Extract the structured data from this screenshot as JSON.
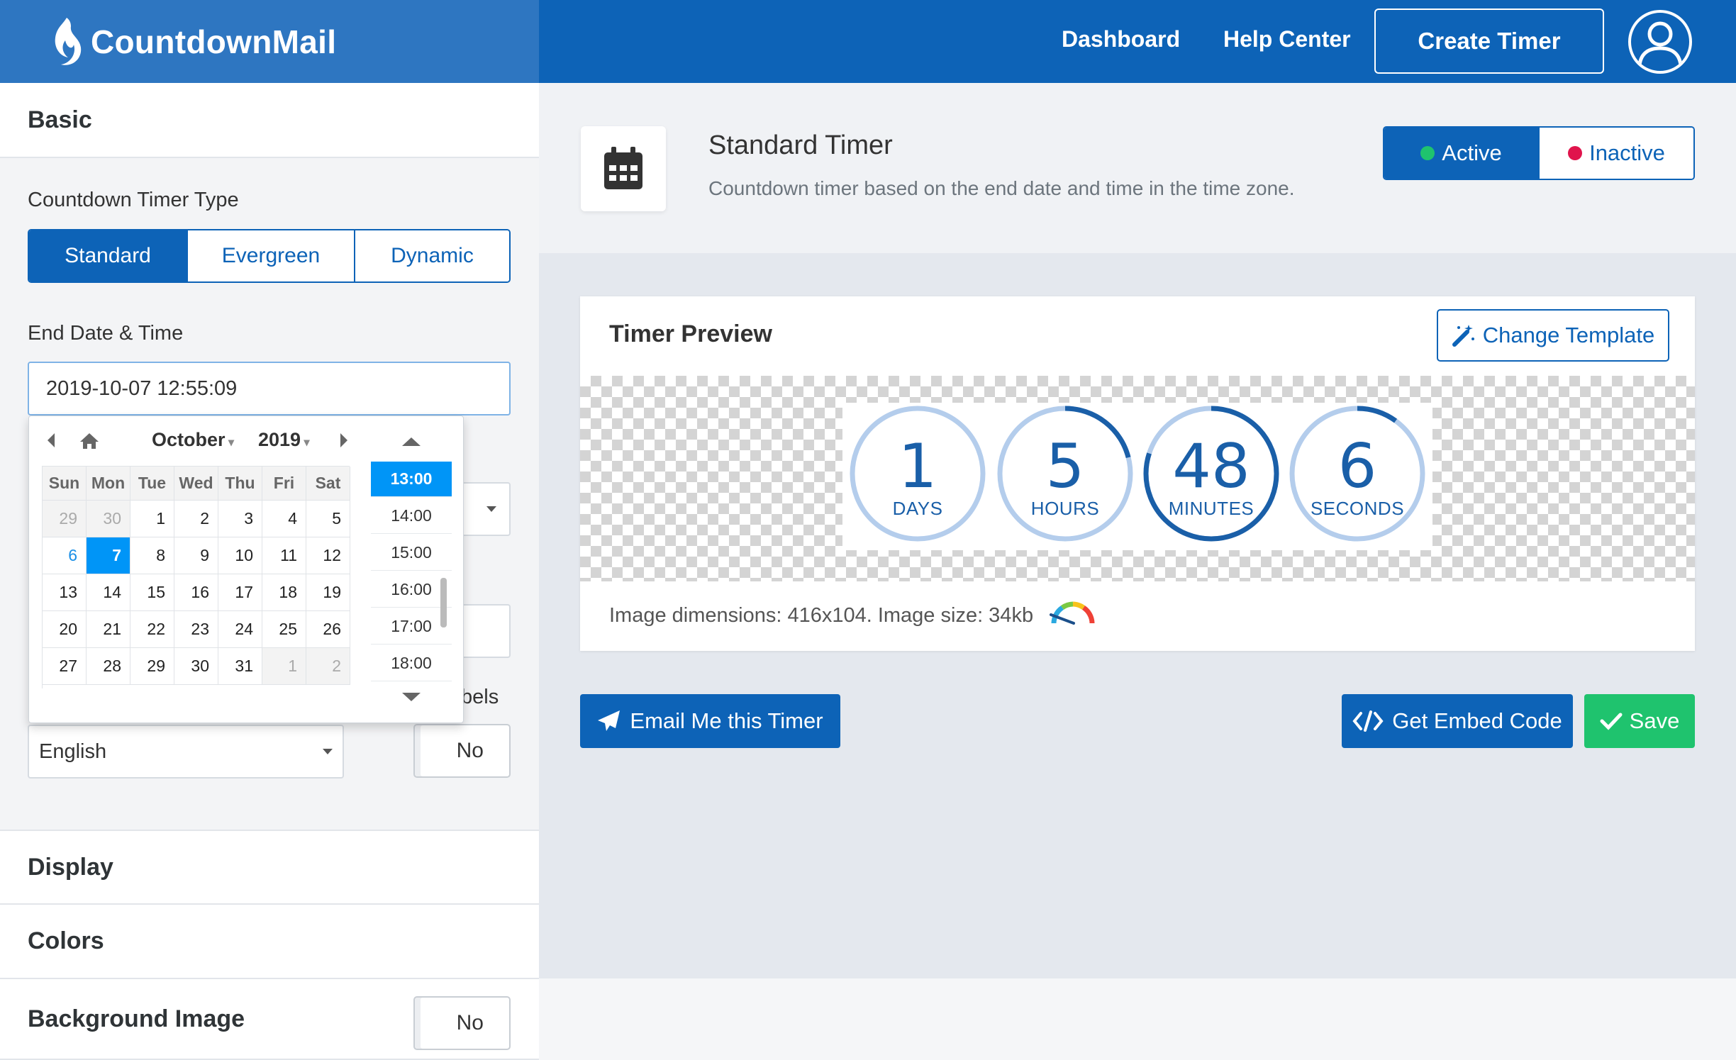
{
  "header": {
    "brand": "CountdownMail",
    "nav": [
      "Dashboard",
      "Help Center"
    ],
    "create_timer": "Create Timer"
  },
  "sidebar": {
    "basic": "Basic",
    "timer_type_label": "Countdown Timer Type",
    "timer_types": [
      "Standard",
      "Evergreen",
      "Dynamic"
    ],
    "end_label": "End Date & Time",
    "end_value": "2019-10-07 12:55:09",
    "labels_partial": "bels",
    "language": "English",
    "labels_toggle": "No",
    "display": "Display",
    "colors": "Colors",
    "bg_image": "Background Image",
    "bg_image_toggle": "No"
  },
  "datepicker": {
    "month": "October",
    "year": "2019",
    "weekdays": [
      "Sun",
      "Mon",
      "Tue",
      "Wed",
      "Thu",
      "Fri",
      "Sat"
    ],
    "days": [
      "29",
      "30",
      "1",
      "2",
      "3",
      "4",
      "5",
      "6",
      "7",
      "8",
      "9",
      "10",
      "11",
      "12",
      "13",
      "14",
      "15",
      "16",
      "17",
      "18",
      "19",
      "20",
      "21",
      "22",
      "23",
      "24",
      "25",
      "26",
      "27",
      "28",
      "29",
      "30",
      "31",
      "1",
      "2"
    ],
    "times": [
      "13:00",
      "14:00",
      "15:00",
      "16:00",
      "17:00",
      "18:00"
    ]
  },
  "main": {
    "title": "Standard Timer",
    "description": "Countdown timer based on the end date and time in the time zone.",
    "status": [
      "Active",
      "Inactive"
    ],
    "preview_title": "Timer Preview",
    "change_template": "Change Template",
    "image_info": "Image dimensions: 416x104. Image size: 34kb",
    "email_btn": "Email Me this Timer",
    "embed_btn": "Get Embed Code",
    "save_btn": "Save"
  },
  "timer": [
    {
      "value": "1",
      "label": "DAYS",
      "fraction": 0.0
    },
    {
      "value": "5",
      "label": "HOURS",
      "fraction": 0.21
    },
    {
      "value": "48",
      "label": "MINUTES",
      "fraction": 0.8
    },
    {
      "value": "6",
      "label": "SECONDS",
      "fraction": 0.1
    }
  ],
  "colors": {
    "primary": "#0d63b7",
    "success": "#1fc36e",
    "active_dot": "#1fc36e",
    "inactive_dot": "#e0144c"
  }
}
